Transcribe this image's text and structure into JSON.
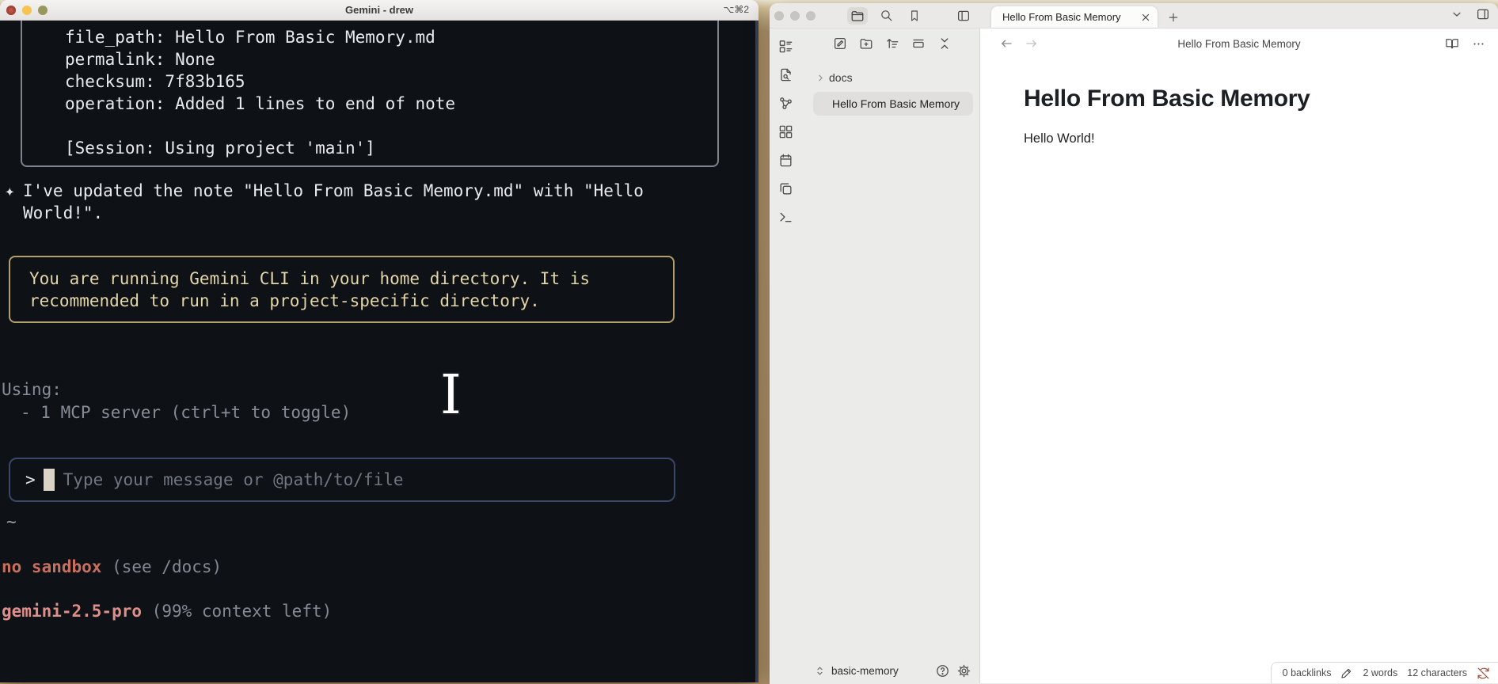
{
  "terminal": {
    "title": "Gemini - drew",
    "shortcut": "⌥⌘2",
    "tool_output": {
      "lines": [
        "file_path: Hello From Basic Memory.md",
        "permalink: None",
        "checksum: 7f83b165",
        "operation: Added 1 lines to end of note",
        "",
        "[Session: Using project 'main']"
      ]
    },
    "message": {
      "marker": "✦",
      "lines": [
        "I've updated the note \"Hello From Basic Memory.md\" with \"Hello",
        "World!\"."
      ]
    },
    "warning": {
      "lines": [
        "You are running Gemini CLI in your home directory. It is",
        "recommended to run in a project-specific directory."
      ]
    },
    "using": {
      "label": "Using:",
      "item": "- 1 MCP server (ctrl+t to toggle)"
    },
    "input": {
      "prompt": ">",
      "placeholder": "Type your message or @path/to/file"
    },
    "cwd": "~",
    "footer": {
      "sandbox": "no sandbox",
      "sandbox_hint": "(see /docs)",
      "model": "gemini-2.5-pro",
      "context": "(99% context left)"
    },
    "cursor_glyph": "I"
  },
  "obsidian": {
    "tab_title": "Hello From Basic Memory",
    "header_title": "Hello From Basic Memory",
    "tree": {
      "folder": "docs",
      "file": "Hello From Basic Memory"
    },
    "note": {
      "heading": "Hello From Basic Memory",
      "body": "Hello World!"
    },
    "vault_name": "basic-memory",
    "status": {
      "backlinks": "0 backlinks",
      "words": "2 words",
      "characters": "12 characters"
    }
  },
  "icons": [
    "folder-icon",
    "search-icon",
    "bookmark-icon",
    "panel-left-icon",
    "close-icon",
    "plus-icon",
    "chevron-down-icon",
    "panel-right-icon",
    "new-note-icon",
    "new-folder-icon",
    "sort-icon",
    "stacked-panel-icon",
    "collapse-icon",
    "layout-list-icon",
    "file-search-icon",
    "graph-icon",
    "layout-grid-icon",
    "calendar-icon",
    "copy-icon",
    "terminal-icon",
    "chevron-right-icon",
    "back-arrow-icon",
    "forward-arrow-icon",
    "book-icon",
    "more-icon",
    "vault-switcher-icon",
    "help-icon",
    "gear-icon",
    "pencil-icon",
    "sync-off-icon",
    "sparkle-icon",
    "ibeam-cursor"
  ],
  "colors": {
    "terminal_bg": "#0e1116",
    "warning": "#e3d6a9",
    "input_border": "#3a4766",
    "sandbox_red": "#c8705f",
    "model_pink": "#dd8f8a",
    "accent_purple": "#7b6cd9",
    "sync_off": "#9c4a38"
  }
}
